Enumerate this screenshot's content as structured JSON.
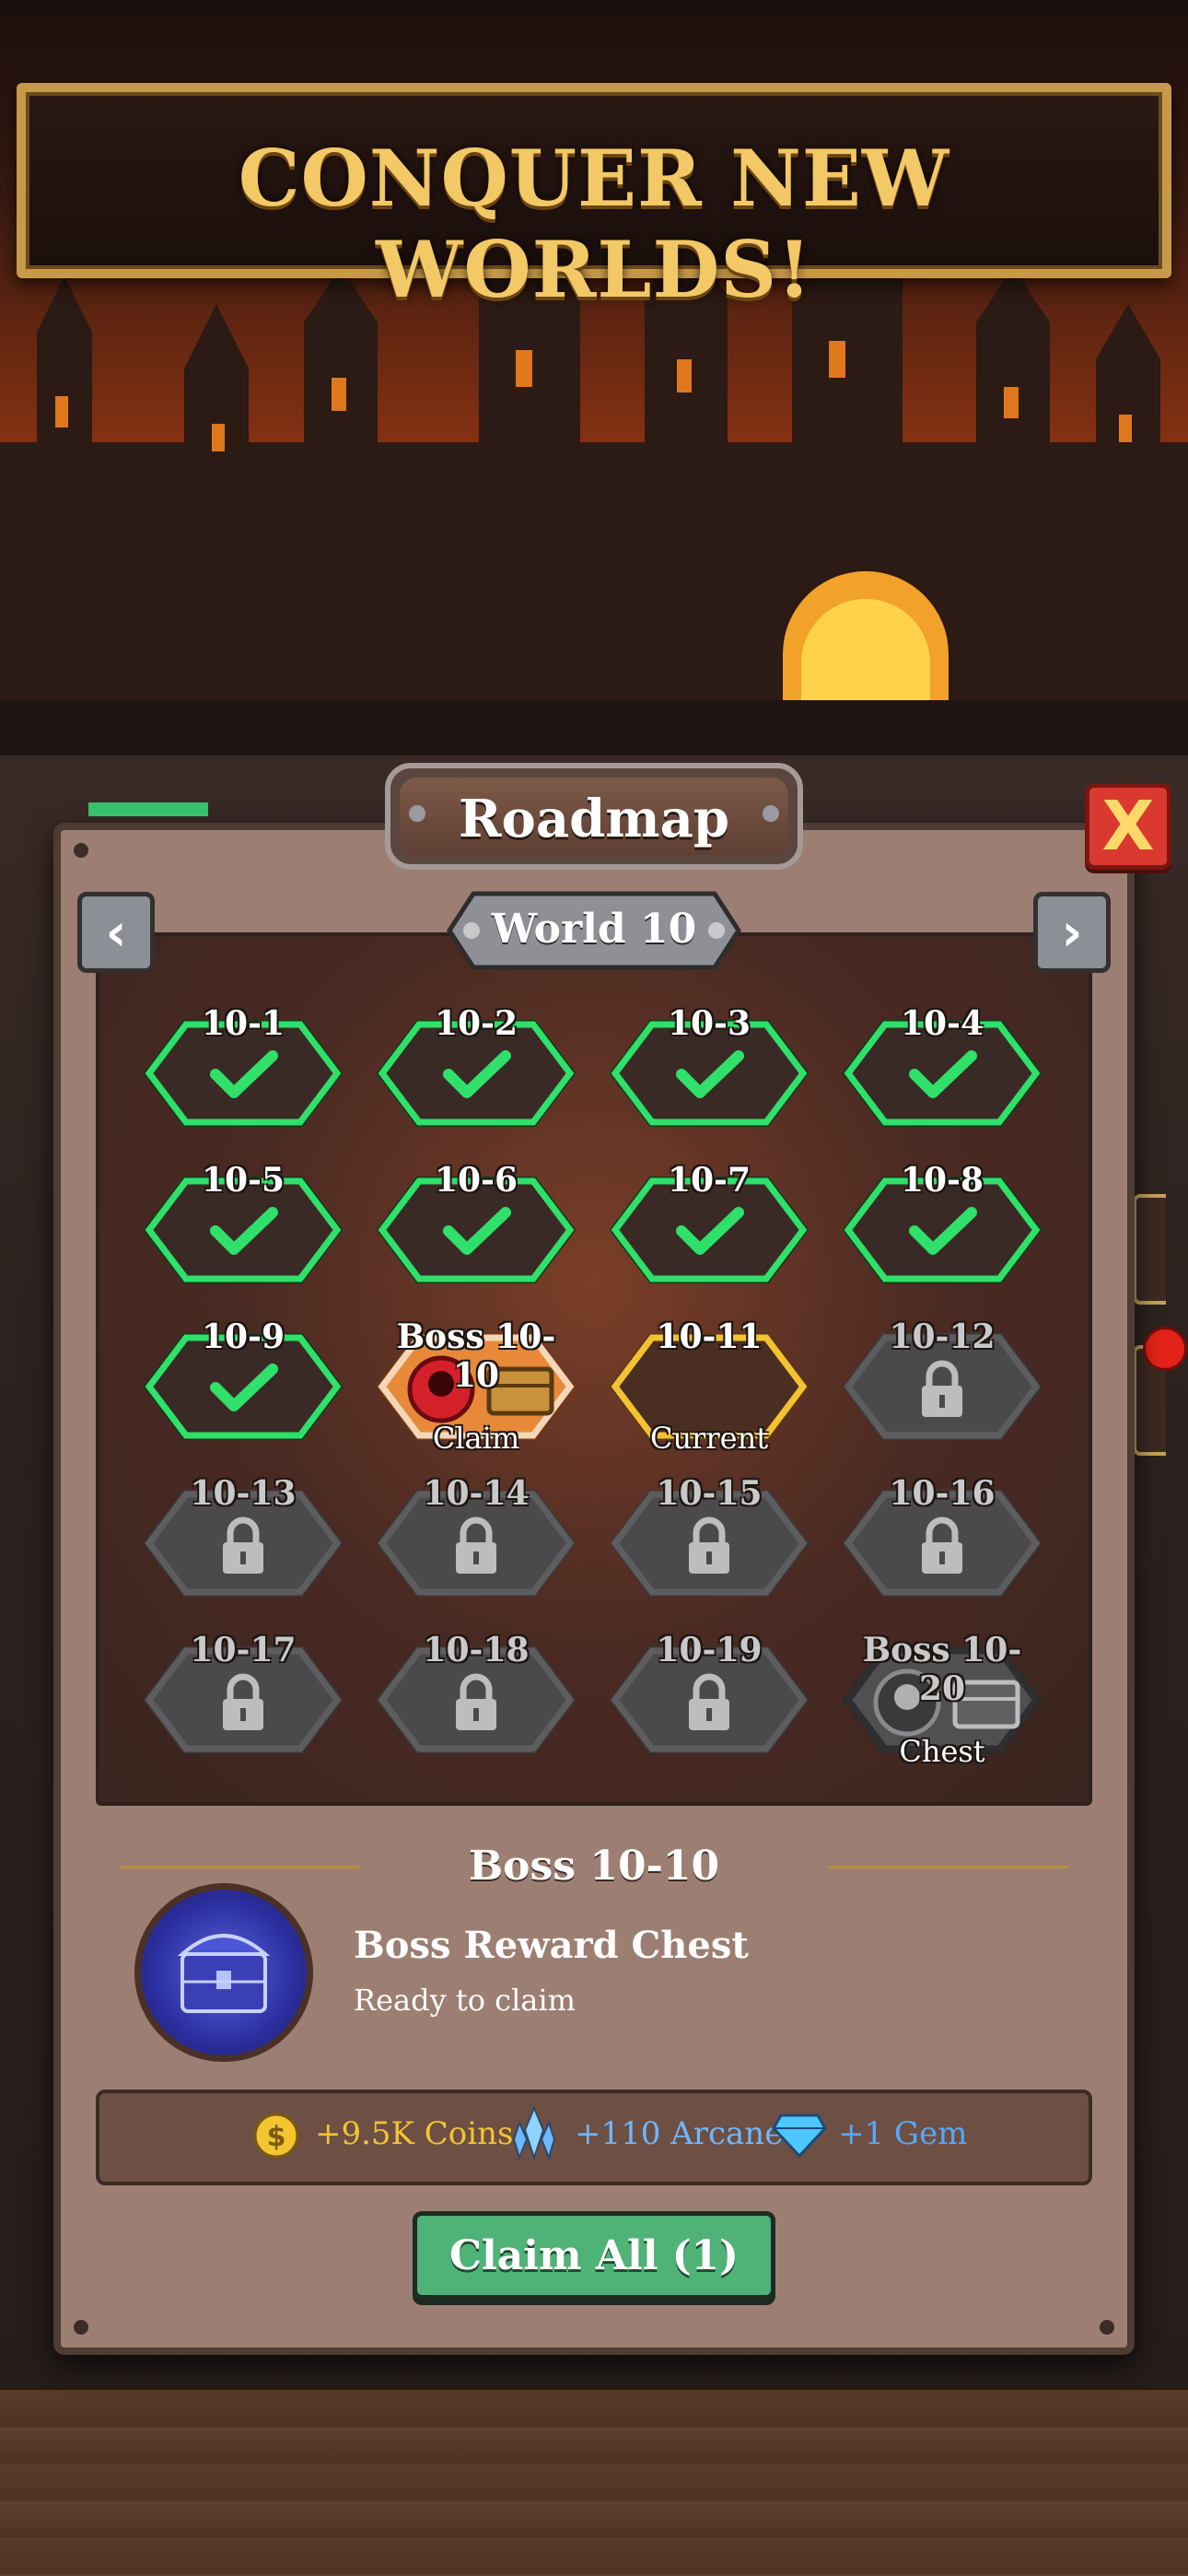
{
  "banner": {
    "title": "CONQUER NEW WORLDS!"
  },
  "panel": {
    "title": "Roadmap",
    "close_label": "X",
    "world": {
      "title": "World 10",
      "prev_label": "‹",
      "next_label": "›"
    }
  },
  "levels": [
    {
      "label": "10-1",
      "state": "completed"
    },
    {
      "label": "10-2",
      "state": "completed"
    },
    {
      "label": "10-3",
      "state": "completed"
    },
    {
      "label": "10-4",
      "state": "completed"
    },
    {
      "label": "10-5",
      "state": "completed"
    },
    {
      "label": "10-6",
      "state": "completed"
    },
    {
      "label": "10-7",
      "state": "completed"
    },
    {
      "label": "10-8",
      "state": "completed"
    },
    {
      "label": "10-9",
      "state": "completed"
    },
    {
      "label": "Boss 10-10",
      "state": "boss-claim",
      "sub": "Claim"
    },
    {
      "label": "10-11",
      "state": "current",
      "sub": "Current"
    },
    {
      "label": "10-12",
      "state": "locked"
    },
    {
      "label": "10-13",
      "state": "locked"
    },
    {
      "label": "10-14",
      "state": "locked"
    },
    {
      "label": "10-15",
      "state": "locked"
    },
    {
      "label": "10-16",
      "state": "locked"
    },
    {
      "label": "10-17",
      "state": "locked"
    },
    {
      "label": "10-18",
      "state": "locked"
    },
    {
      "label": "10-19",
      "state": "locked"
    },
    {
      "label": "Boss 10-20",
      "state": "boss-locked",
      "sub": "Chest"
    }
  ],
  "selected": {
    "title": "Boss 10-10",
    "reward_name": "Boss Reward Chest",
    "reward_status": "Ready to claim",
    "resources": [
      {
        "icon": "coin-icon",
        "text": "+9.5K Coins",
        "color": "#f2c531"
      },
      {
        "icon": "arcane-crystal-icon",
        "text": "+110 Arcane",
        "color": "#6fb7ff"
      },
      {
        "icon": "gem-icon",
        "text": "+1 Gem",
        "color": "#55a8ff"
      }
    ]
  },
  "claim_button": {
    "label": "Claim All (1)"
  },
  "colors": {
    "completed": "#2fe06a",
    "current": "#f2c231",
    "boss_claim": "#e8893a",
    "locked": "#5d5d5f",
    "panel": "#9c7f72"
  }
}
